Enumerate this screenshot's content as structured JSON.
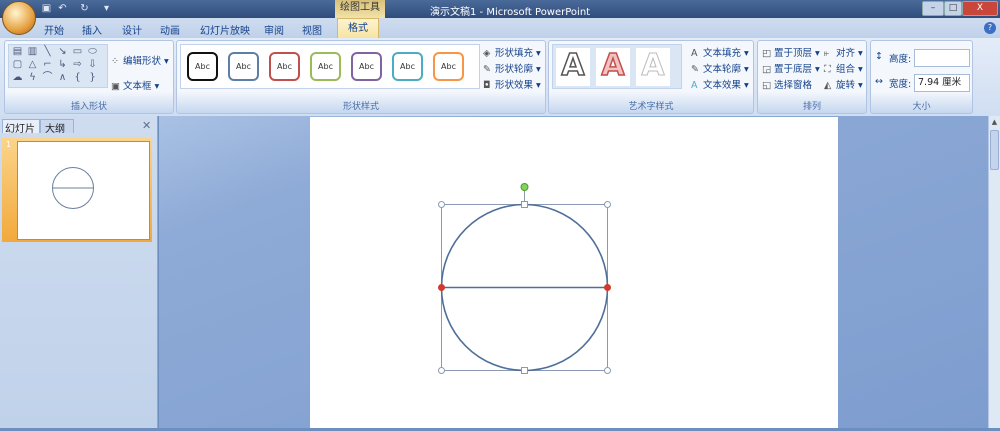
{
  "titlebar": {
    "title": "演示文稿1 - Microsoft PowerPoint",
    "context_tool": "绘图工具",
    "minimize": "–",
    "restore": "□",
    "close": "X"
  },
  "tabs": [
    "开始",
    "插入",
    "设计",
    "动画",
    "幻灯片放映",
    "审阅",
    "视图",
    "格式"
  ],
  "active_tab": "格式",
  "ribbon": {
    "insert_shapes": {
      "label": "插入形状",
      "edit_shape": "编辑形状",
      "text_box": "文本框"
    },
    "shape_styles": {
      "label": "形状样式",
      "samples": [
        "Abc",
        "Abc",
        "Abc",
        "Abc",
        "Abc",
        "Abc",
        "Abc"
      ],
      "sample_colors": [
        "#111111",
        "#5b7fa8",
        "#c0504d",
        "#9bbb59",
        "#8064a2",
        "#4bacc6",
        "#f79646"
      ],
      "fill": "形状填充",
      "outline": "形状轮廓",
      "effects": "形状效果"
    },
    "wordart_styles": {
      "label": "艺术字样式",
      "samples": [
        "A",
        "A",
        "A"
      ],
      "text_fill": "文本填充",
      "text_outline": "文本轮廓",
      "text_effects": "文本效果"
    },
    "arrange": {
      "label": "排列",
      "bring_front": "置于顶层",
      "send_back": "置于底层",
      "selection_pane": "选择窗格",
      "align": "对齐",
      "group": "组合",
      "rotate": "旋转"
    },
    "size": {
      "label": "大小",
      "height_label": "高度:",
      "height_value": "",
      "width_label": "宽度:",
      "width_value": "7.94 厘米"
    }
  },
  "left_panel": {
    "tab_slides": "幻灯片",
    "tab_outline": "大纲",
    "close": "✕",
    "slide_number": "1"
  }
}
